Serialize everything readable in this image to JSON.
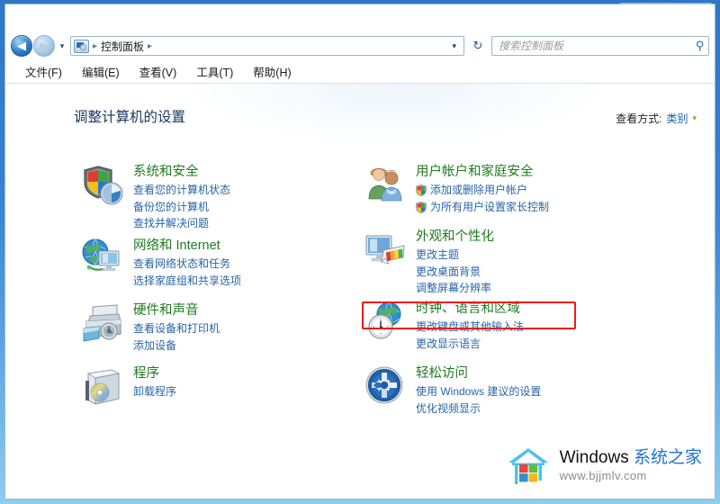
{
  "window": {
    "titlebar_buttons": [
      {
        "name": "minimize",
        "label": "—"
      },
      {
        "name": "maximize",
        "label": "□"
      },
      {
        "name": "close",
        "label": "✕"
      }
    ]
  },
  "navbar": {
    "back_glyph": "◀",
    "forward_glyph": "▶",
    "history_glyph": "▾",
    "breadcrumb_icon": "control-panel-icon",
    "breadcrumb_lead_sep": "▸",
    "breadcrumb_text": "控制面板",
    "breadcrumb_trail_sep": "▸",
    "address_dropdown_glyph": "▾",
    "refresh_glyph": "↻",
    "search_placeholder": "搜索控制面板",
    "search_value": "",
    "search_icon_glyph": "⚲"
  },
  "menubar": {
    "items": [
      {
        "label": "文件(F)"
      },
      {
        "label": "编辑(E)"
      },
      {
        "label": "查看(V)"
      },
      {
        "label": "工具(T)"
      },
      {
        "label": "帮助(H)"
      }
    ]
  },
  "content": {
    "page_title": "调整计算机的设置",
    "view_by": {
      "label": "查看方式:",
      "value": "类别",
      "arrow": "▾"
    }
  },
  "categories": {
    "left": [
      {
        "id": "system-and-security",
        "icon": "shield-pie-icon",
        "title": "系统和安全",
        "links": [
          {
            "label": "查看您的计算机状态",
            "shield": false
          },
          {
            "label": "备份您的计算机",
            "shield": false
          },
          {
            "label": "查找并解决问题",
            "shield": false
          }
        ]
      },
      {
        "id": "network-and-internet",
        "icon": "globe-monitor-icon",
        "title": "网络和 Internet",
        "links": [
          {
            "label": "查看网络状态和任务",
            "shield": false
          },
          {
            "label": "选择家庭组和共享选项",
            "shield": false
          }
        ]
      },
      {
        "id": "hardware-and-sound",
        "icon": "printer-icon",
        "title": "硬件和声音",
        "links": [
          {
            "label": "查看设备和打印机",
            "shield": false
          },
          {
            "label": "添加设备",
            "shield": false
          }
        ]
      },
      {
        "id": "programs",
        "icon": "programs-box-icon",
        "title": "程序",
        "links": [
          {
            "label": "卸载程序",
            "shield": false
          }
        ]
      }
    ],
    "right": [
      {
        "id": "user-accounts-and-family-safety",
        "icon": "users-icon",
        "title": "用户帐户和家庭安全",
        "links": [
          {
            "label": "添加或删除用户帐户",
            "shield": true
          },
          {
            "label": "为所有用户设置家长控制",
            "shield": true
          }
        ]
      },
      {
        "id": "appearance-and-personalization",
        "icon": "monitor-palette-icon",
        "title": "外观和个性化",
        "links": [
          {
            "label": "更改主题",
            "shield": false
          },
          {
            "label": "更改桌面背景",
            "shield": false
          },
          {
            "label": "调整屏幕分辨率",
            "shield": false
          }
        ]
      },
      {
        "id": "clock-language-and-region",
        "icon": "globe-clock-icon",
        "title": "时钟、语言和区域",
        "highlighted": true,
        "links": [
          {
            "label": "更改键盘或其他输入法",
            "shield": false
          },
          {
            "label": "更改显示语言",
            "shield": false
          }
        ]
      },
      {
        "id": "ease-of-access",
        "icon": "ease-of-access-icon",
        "title": "轻松访问",
        "links": [
          {
            "label": "使用 Windows 建议的设置",
            "shield": false
          },
          {
            "label": "优化视频显示",
            "shield": false
          }
        ]
      }
    ]
  },
  "watermark": {
    "brand_en": "Windows ",
    "brand_cn": "系统之家",
    "url": "www.bjjmlv.com"
  },
  "colors": {
    "accent_blue": "#2864a8",
    "category_title_green": "#1f7a1f",
    "highlight_red": "#ee1b1b",
    "title_navy": "#17365d",
    "titlebar_blue": "#3a82cf"
  }
}
